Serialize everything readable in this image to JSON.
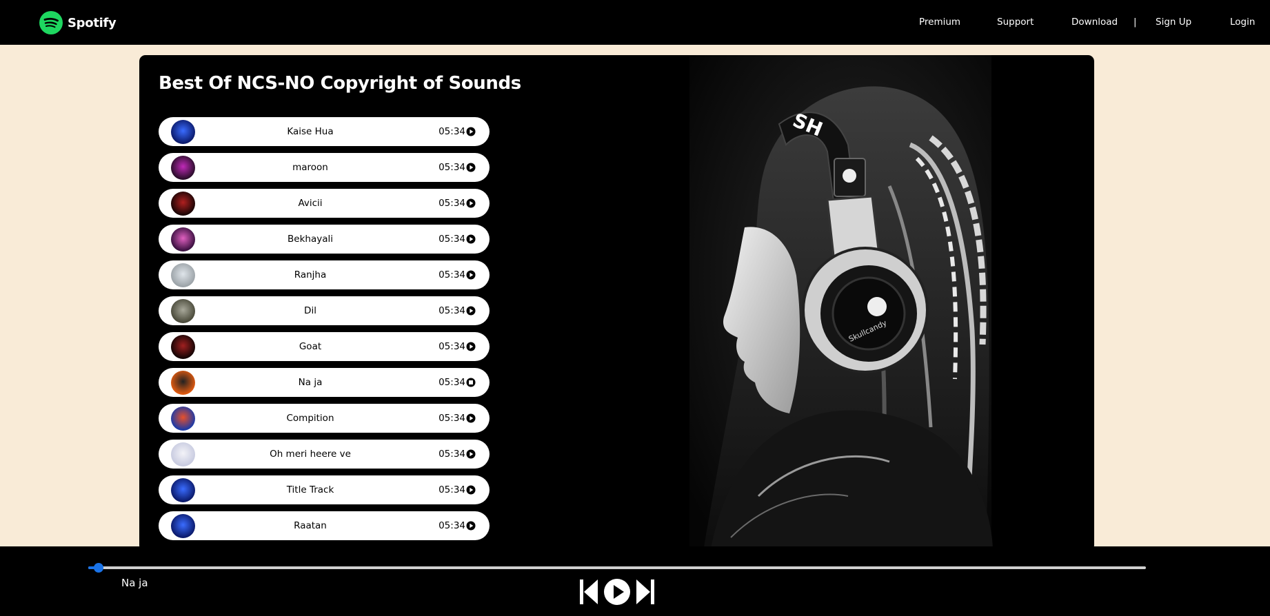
{
  "brand": {
    "name": "Spotify",
    "color": "#1ed760"
  },
  "nav": {
    "links": [
      "Premium",
      "Support",
      "Download",
      "Sign Up",
      "Login"
    ],
    "separator": "|"
  },
  "playlist": {
    "title": "Best Of NCS-NO Copyright of Sounds",
    "songs": [
      {
        "name": "Kaise Hua",
        "duration": "05:34",
        "state": "play-icon"
      },
      {
        "name": "maroon",
        "duration": "05:34",
        "state": "play-icon"
      },
      {
        "name": "Avicii",
        "duration": "05:34",
        "state": "play-icon"
      },
      {
        "name": "Bekhayali",
        "duration": "05:34",
        "state": "play-icon"
      },
      {
        "name": "Ranjha",
        "duration": "05:34",
        "state": "play-icon"
      },
      {
        "name": "Dil",
        "duration": "05:34",
        "state": "play-icon"
      },
      {
        "name": "Goat",
        "duration": "05:34",
        "state": "play-icon"
      },
      {
        "name": "Na ja",
        "duration": "05:34",
        "state": "pause-icon"
      },
      {
        "name": "Compition",
        "duration": "05:34",
        "state": "play-icon"
      },
      {
        "name": "Oh meri heere ve",
        "duration": "05:34",
        "state": "play-icon"
      },
      {
        "name": "Title Track",
        "duration": "05:34",
        "state": "play-icon"
      },
      {
        "name": "Raatan",
        "duration": "05:34",
        "state": "play-icon"
      }
    ]
  },
  "player": {
    "now_playing": "Na ja",
    "progress_percent": 1,
    "accent_color": "#1a73e8",
    "controls": [
      "previous-icon",
      "play-icon",
      "next-icon"
    ]
  }
}
